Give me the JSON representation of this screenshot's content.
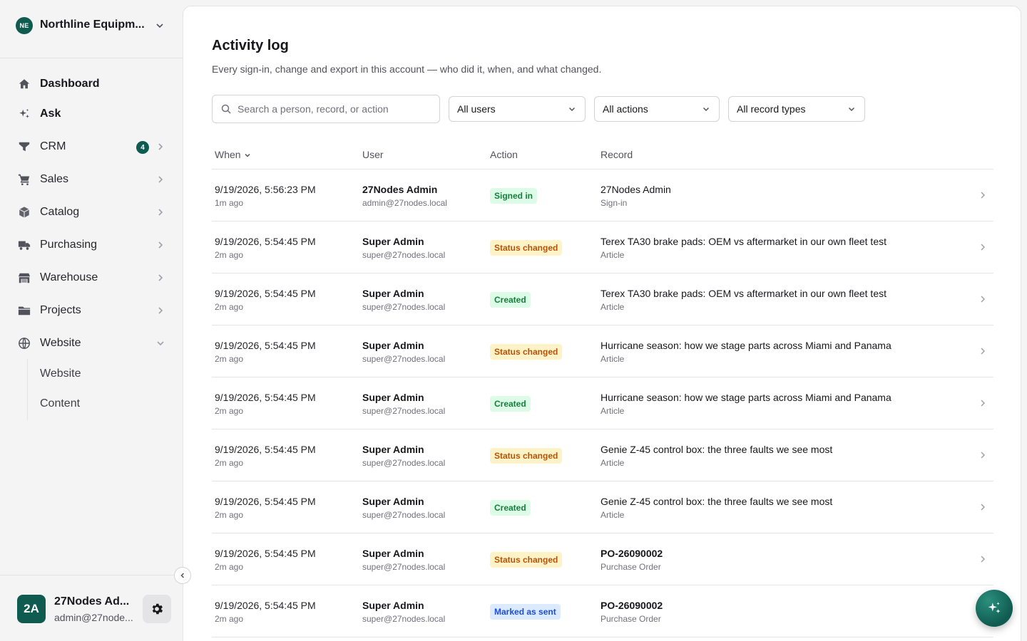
{
  "org": {
    "initials": "NE",
    "name": "Northline Equipm..."
  },
  "nav": {
    "dashboard": "Dashboard",
    "ask": "Ask",
    "crm": "CRM",
    "crm_badge": "4",
    "sales": "Sales",
    "catalog": "Catalog",
    "purchasing": "Purchasing",
    "warehouse": "Warehouse",
    "projects": "Projects",
    "website": "Website",
    "website_sub": [
      "Website",
      "Content"
    ]
  },
  "user": {
    "initials": "2A",
    "name": "27Nodes Ad...",
    "email": "admin@27node..."
  },
  "page": {
    "title": "Activity log",
    "subtitle": "Every sign-in, change and export in this account — who did it, when, and what changed."
  },
  "filters": {
    "search_placeholder": "Search a person, record, or action",
    "users": "All users",
    "actions": "All actions",
    "record_types": "All record types"
  },
  "table": {
    "headers": {
      "when": "When",
      "user": "User",
      "action": "Action",
      "record": "Record"
    },
    "rows": [
      {
        "when": "9/19/2026, 5:56:23 PM",
        "ago": "1m ago",
        "user": "27Nodes Admin",
        "email": "admin@27nodes.local",
        "action": "Signed in",
        "action_color": "green",
        "record": "27Nodes Admin",
        "record_bold": false,
        "type": "Sign-in"
      },
      {
        "when": "9/19/2026, 5:54:45 PM",
        "ago": "2m ago",
        "user": "Super Admin",
        "email": "super@27nodes.local",
        "action": "Status changed",
        "action_color": "amber",
        "record": "Terex TA30 brake pads: OEM vs aftermarket in our own fleet test",
        "record_bold": false,
        "type": "Article"
      },
      {
        "when": "9/19/2026, 5:54:45 PM",
        "ago": "2m ago",
        "user": "Super Admin",
        "email": "super@27nodes.local",
        "action": "Created",
        "action_color": "green",
        "record": "Terex TA30 brake pads: OEM vs aftermarket in our own fleet test",
        "record_bold": false,
        "type": "Article"
      },
      {
        "when": "9/19/2026, 5:54:45 PM",
        "ago": "2m ago",
        "user": "Super Admin",
        "email": "super@27nodes.local",
        "action": "Status changed",
        "action_color": "amber",
        "record": "Hurricane season: how we stage parts across Miami and Panama",
        "record_bold": false,
        "type": "Article"
      },
      {
        "when": "9/19/2026, 5:54:45 PM",
        "ago": "2m ago",
        "user": "Super Admin",
        "email": "super@27nodes.local",
        "action": "Created",
        "action_color": "green",
        "record": "Hurricane season: how we stage parts across Miami and Panama",
        "record_bold": false,
        "type": "Article"
      },
      {
        "when": "9/19/2026, 5:54:45 PM",
        "ago": "2m ago",
        "user": "Super Admin",
        "email": "super@27nodes.local",
        "action": "Status changed",
        "action_color": "amber",
        "record": "Genie Z-45 control box: the three faults we see most",
        "record_bold": false,
        "type": "Article"
      },
      {
        "when": "9/19/2026, 5:54:45 PM",
        "ago": "2m ago",
        "user": "Super Admin",
        "email": "super@27nodes.local",
        "action": "Created",
        "action_color": "green",
        "record": "Genie Z-45 control box: the three faults we see most",
        "record_bold": false,
        "type": "Article"
      },
      {
        "when": "9/19/2026, 5:54:45 PM",
        "ago": "2m ago",
        "user": "Super Admin",
        "email": "super@27nodes.local",
        "action": "Status changed",
        "action_color": "amber",
        "record": "PO-26090002",
        "record_bold": true,
        "type": "Purchase Order"
      },
      {
        "when": "9/19/2026, 5:54:45 PM",
        "ago": "2m ago",
        "user": "Super Admin",
        "email": "super@27nodes.local",
        "action": "Marked as sent",
        "action_color": "blue",
        "record": "PO-26090002",
        "record_bold": true,
        "type": "Purchase Order"
      }
    ]
  },
  "colors": {
    "brand": "#0f5b4f",
    "green_pill": "#dcfce7",
    "amber_pill": "#fef3c7",
    "blue_pill": "#dbeafe"
  }
}
